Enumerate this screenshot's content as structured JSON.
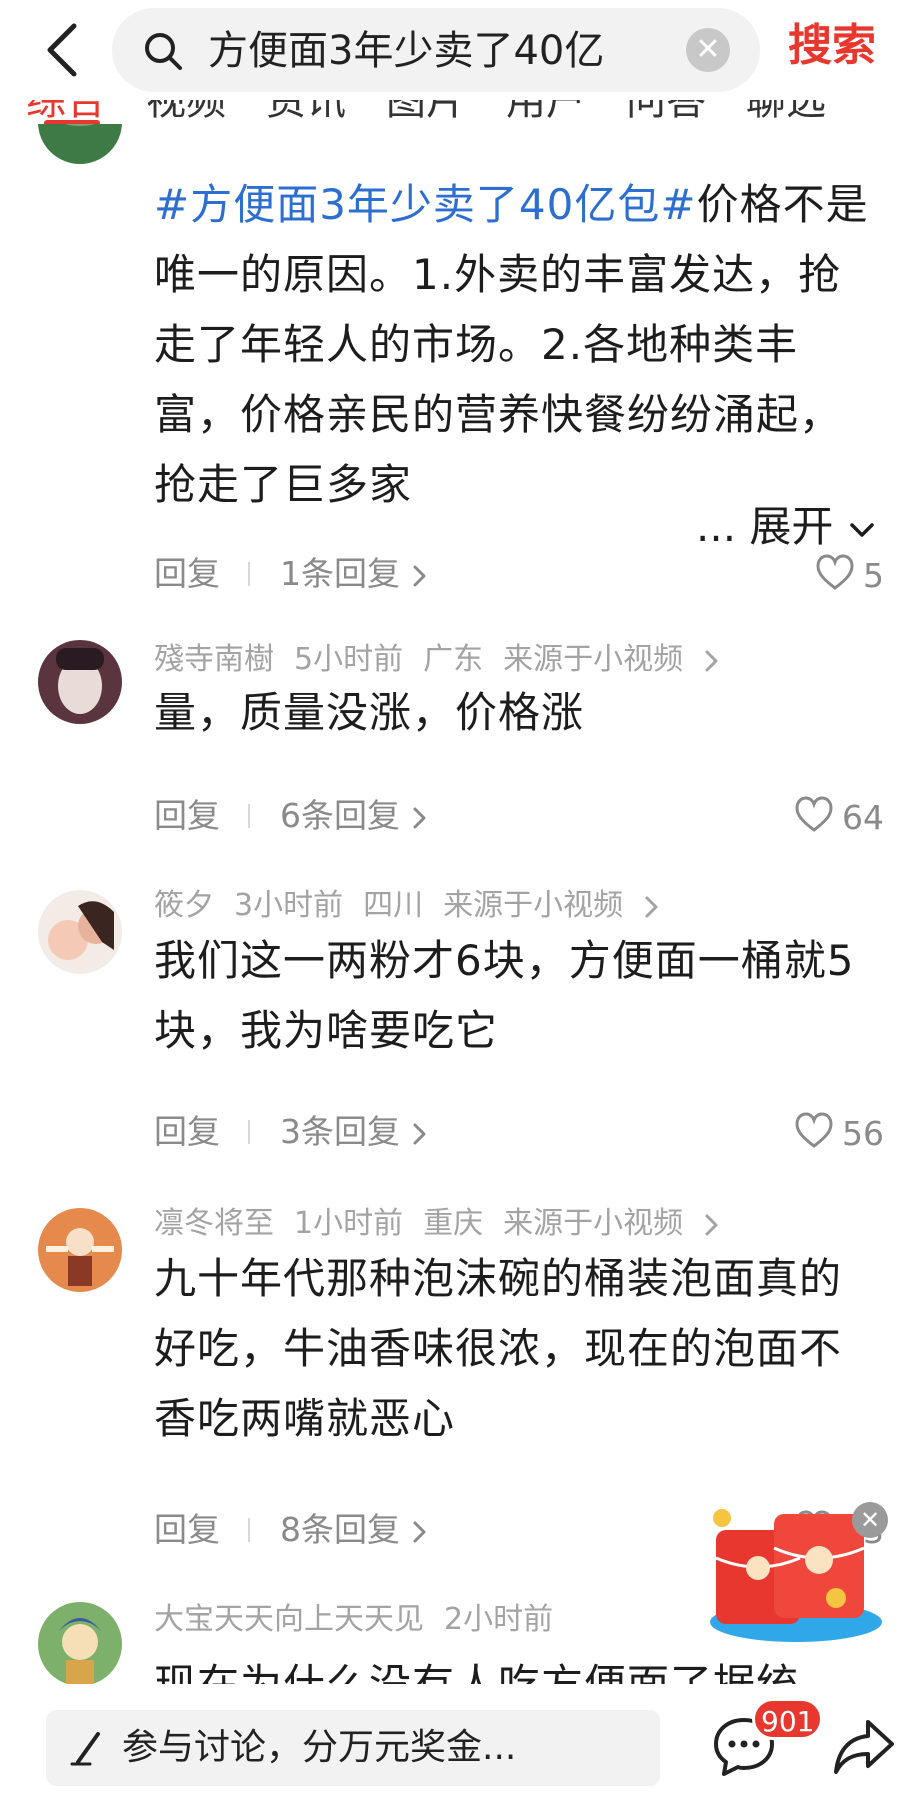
{
  "header": {
    "search_query": "方便面3年少卖了40亿",
    "clear_symbol": "✕",
    "search_button": "搜索",
    "tabs": [
      "综合",
      "视频",
      "资讯",
      "图片",
      "用户",
      "问答",
      "聊选"
    ]
  },
  "comments": [
    {
      "hashtag": "#方便面3年少卖了40亿包#",
      "text": "价格不是唯一的原因。1.外卖的丰富发达，抢走了年轻人的市场。2.各地种类丰富，价格亲民的营养快餐纷纷涌起，抢走了巨多家",
      "expand": "... 展开",
      "reply_label": "回复",
      "replies": "1条回复",
      "likes": "5"
    },
    {
      "user": "殘寺南樹",
      "time": "5小时前",
      "location": "广东",
      "source": "来源于小视频",
      "text": "量，质量没涨，价格涨",
      "reply_label": "回复",
      "replies": "6条回复",
      "likes": "64"
    },
    {
      "user": "筱夕",
      "time": "3小时前",
      "location": "四川",
      "source": "来源于小视频",
      "text": "我们这一两粉才6块，方便面一桶就5块，我为啥要吃它",
      "reply_label": "回复",
      "replies": "3条回复",
      "likes": "56"
    },
    {
      "user": "凛冬将至",
      "time": "1小时前",
      "location": "重庆",
      "source": "来源于小视频",
      "text": "九十年代那种泡沫碗的桶装泡面真的好吃，牛油香味很浓，现在的泡面不香吃两嘴就恶心",
      "reply_label": "回复",
      "replies": "8条回复",
      "likes": "53"
    },
    {
      "user": "大宝天天向上天天见",
      "time": "2小时前",
      "text": "现在为什么没有人吃方便面了据统"
    }
  ],
  "bottom": {
    "discuss_placeholder": "参与讨论，分万元奖金...",
    "comment_count": "901"
  },
  "colors": {
    "accent": "#e8372f",
    "hashtag": "#2d6fd0",
    "meta": "#a3a3a3"
  },
  "icons": [
    "back-icon",
    "search-icon",
    "clear-icon",
    "heart-icon",
    "chevron-right-icon",
    "chevron-down-icon",
    "red-packet-icon",
    "pen-icon",
    "comment-icon",
    "share-icon"
  ]
}
